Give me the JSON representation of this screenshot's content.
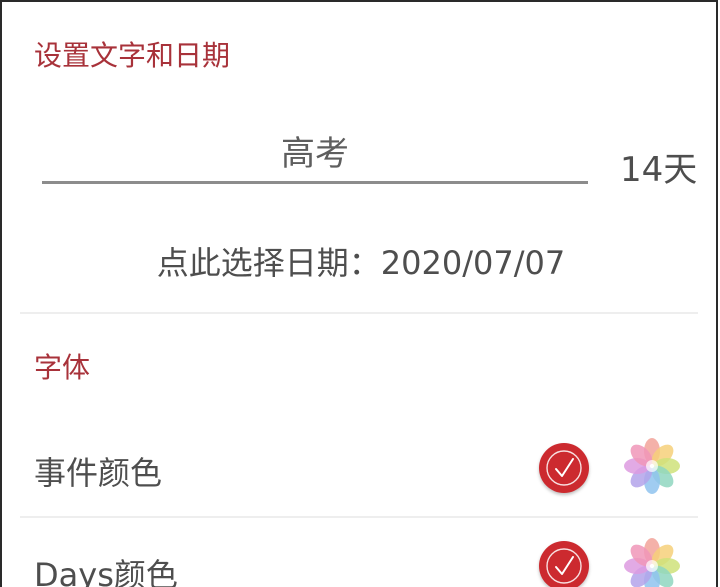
{
  "section_text": {
    "title": "设置文字和日期",
    "name_value": "高考",
    "days_remaining": "14天",
    "date_picker_label": "点此选择日期：2020/07/07"
  },
  "section_font": {
    "title": "字体",
    "rows": [
      {
        "label": "事件颜色",
        "selected_color": "#cc2a2f",
        "picker_icon": "flower-palette-icon"
      },
      {
        "label": "Days颜色",
        "selected_color": "#cc2a2f",
        "picker_icon": "flower-palette-icon"
      }
    ]
  },
  "colors": {
    "accent": "#a8323a",
    "check_fill": "#cc2a2f",
    "underline": "#8c8c8c"
  },
  "icons": {
    "check": "check-icon",
    "palette": "flower-palette-icon"
  }
}
